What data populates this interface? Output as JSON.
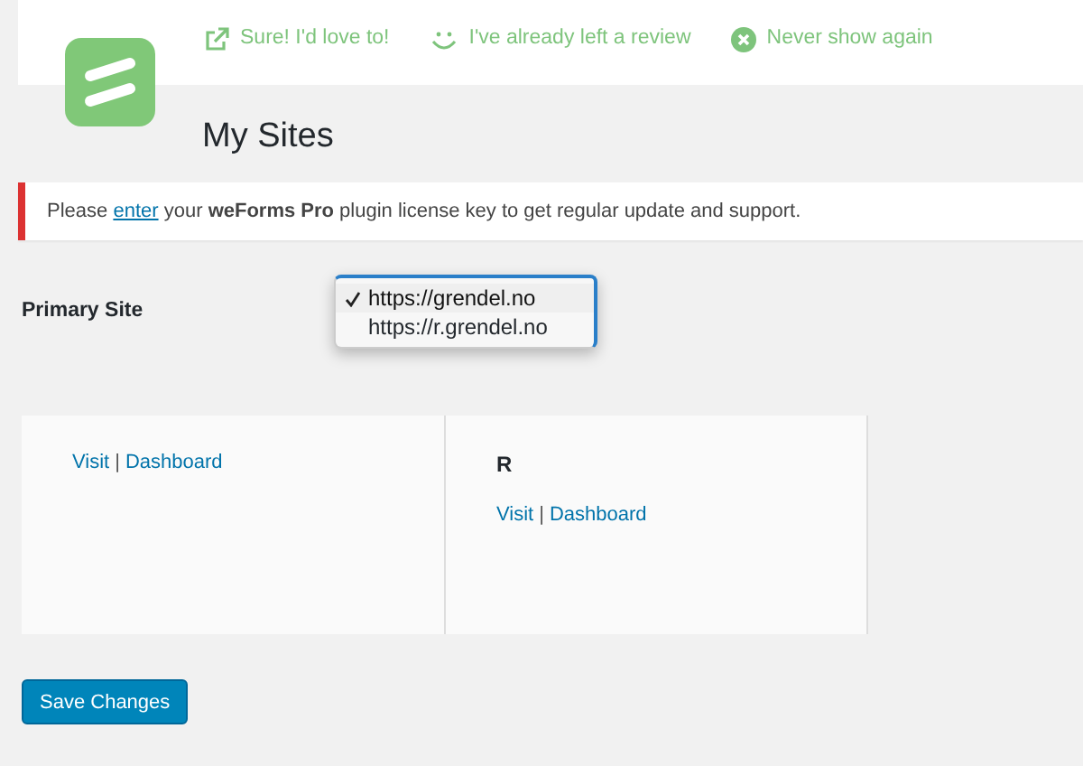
{
  "review_notice": {
    "actions": [
      {
        "kind": "external",
        "label": "Sure! I'd love to!"
      },
      {
        "kind": "smile",
        "label": "I've already left a review"
      },
      {
        "kind": "dismiss",
        "label": "Never show again"
      }
    ]
  },
  "page_title": "My Sites",
  "license_notice": {
    "before": "Please",
    "link": "enter",
    "after": "your **weForms Pro** plugin license key to get regular update and support."
  },
  "primary_site": {
    "label": "Primary Site",
    "options": [
      {
        "label": "https://grendel.no",
        "selected": true
      },
      {
        "label": "https://r.grendel.no",
        "selected": false
      }
    ]
  },
  "sites": [
    {
      "links": [
        "Visit",
        "Dashboard"
      ],
      "separator": "|"
    },
    {
      "title": "R",
      "links": [
        "Visit",
        "Dashboard"
      ],
      "separator": "|"
    }
  ],
  "save_button": "Save Changes"
}
